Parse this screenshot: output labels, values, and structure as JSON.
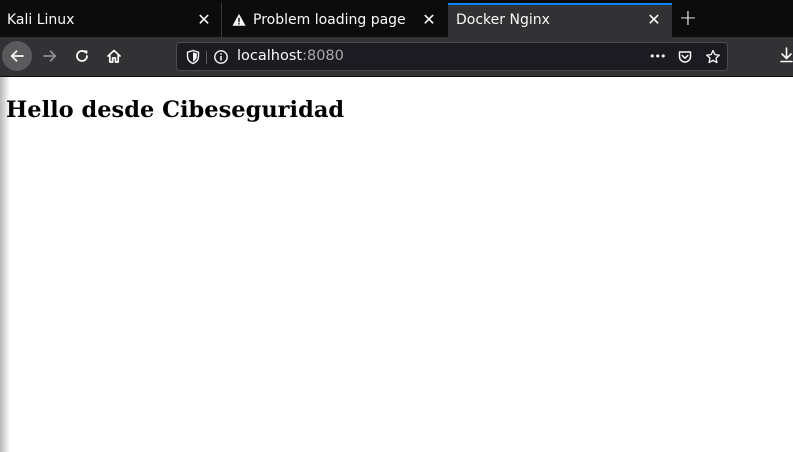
{
  "browser": {
    "tabs": [
      {
        "title": "Kali Linux",
        "active": false,
        "icon": "none"
      },
      {
        "title": "Problem loading page",
        "active": false,
        "icon": "warning-icon"
      },
      {
        "title": "Docker Nginx",
        "active": true,
        "icon": "none"
      }
    ],
    "close_glyph": "✕",
    "new_tab_glyph": "+"
  },
  "toolbar": {
    "url_host": "localhost",
    "url_port": ":8080",
    "page_actions_glyph": "•••"
  },
  "colors": {
    "tabstrip_bg": "#0c0c0d",
    "toolbar_bg": "#323234",
    "active_tab_accent": "#0a84ff",
    "urlbar_bg": "#1c1b22",
    "page_bg": "#ffffff"
  },
  "page": {
    "heading": "Hello desde Cibeseguridad"
  }
}
